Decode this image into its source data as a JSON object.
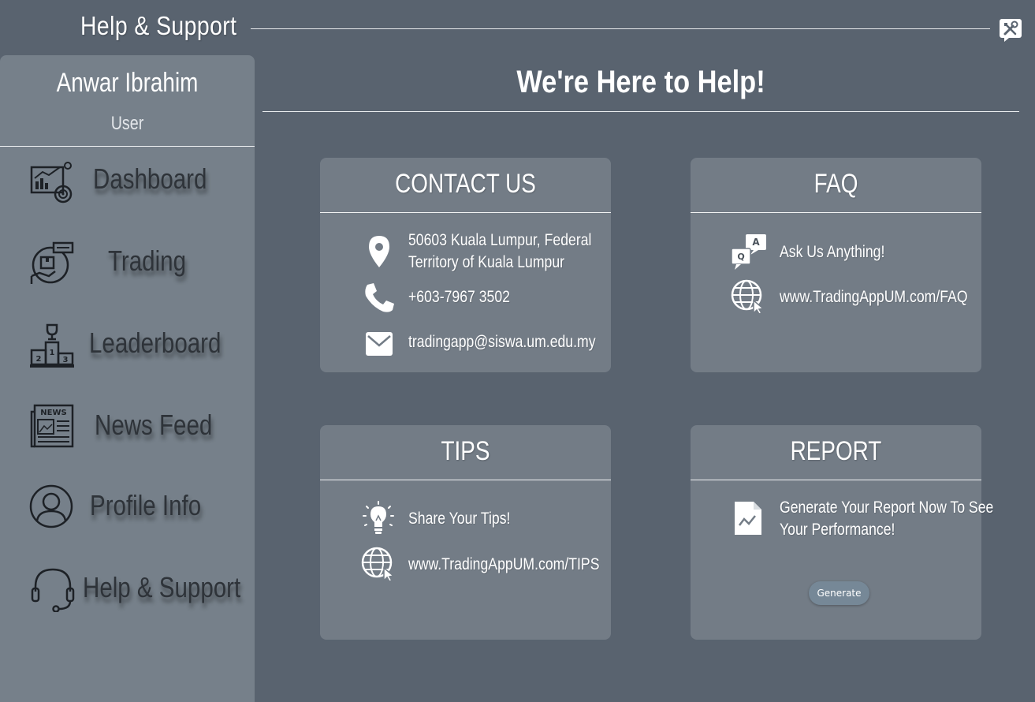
{
  "window": {
    "title": "Help & Support"
  },
  "sidebar": {
    "user_name": "Anwar Ibrahim",
    "user_role": "User",
    "items": [
      {
        "label": "Dashboard",
        "icon": "dashboard-icon"
      },
      {
        "label": "Trading",
        "icon": "trading-icon"
      },
      {
        "label": "Leaderboard",
        "icon": "podium-icon"
      },
      {
        "label": "News Feed",
        "icon": "newspaper-icon"
      },
      {
        "label": "Profile Info",
        "icon": "profile-icon"
      },
      {
        "label": "Help & Support",
        "icon": "headset-icon"
      }
    ]
  },
  "main": {
    "title": "We're Here to Help!",
    "contact": {
      "title": "CONTACT US",
      "address_line1": "50603 Kuala Lumpur, Federal",
      "address_line2": "Territory of Kuala Lumpur",
      "phone": "+603-7967 3502",
      "email": "tradingapp@siswa.um.edu.my"
    },
    "faq": {
      "title": "FAQ",
      "prompt": "Ask Us Anything!",
      "link": "www.TradingAppUM.com/FAQ"
    },
    "tips": {
      "title": "TIPS",
      "prompt": "Share Your Tips!",
      "link": "www.TradingAppUM.com/TIPS"
    },
    "report": {
      "title": "REPORT",
      "line1": "Generate Your Report Now To See",
      "line2": "Your Performance!",
      "button": "Generate"
    }
  },
  "colors": {
    "background": "#59636f",
    "sidebar": "#76808a",
    "card": "#737c86",
    "nav_text": "#2e3339",
    "button": "#768897"
  }
}
